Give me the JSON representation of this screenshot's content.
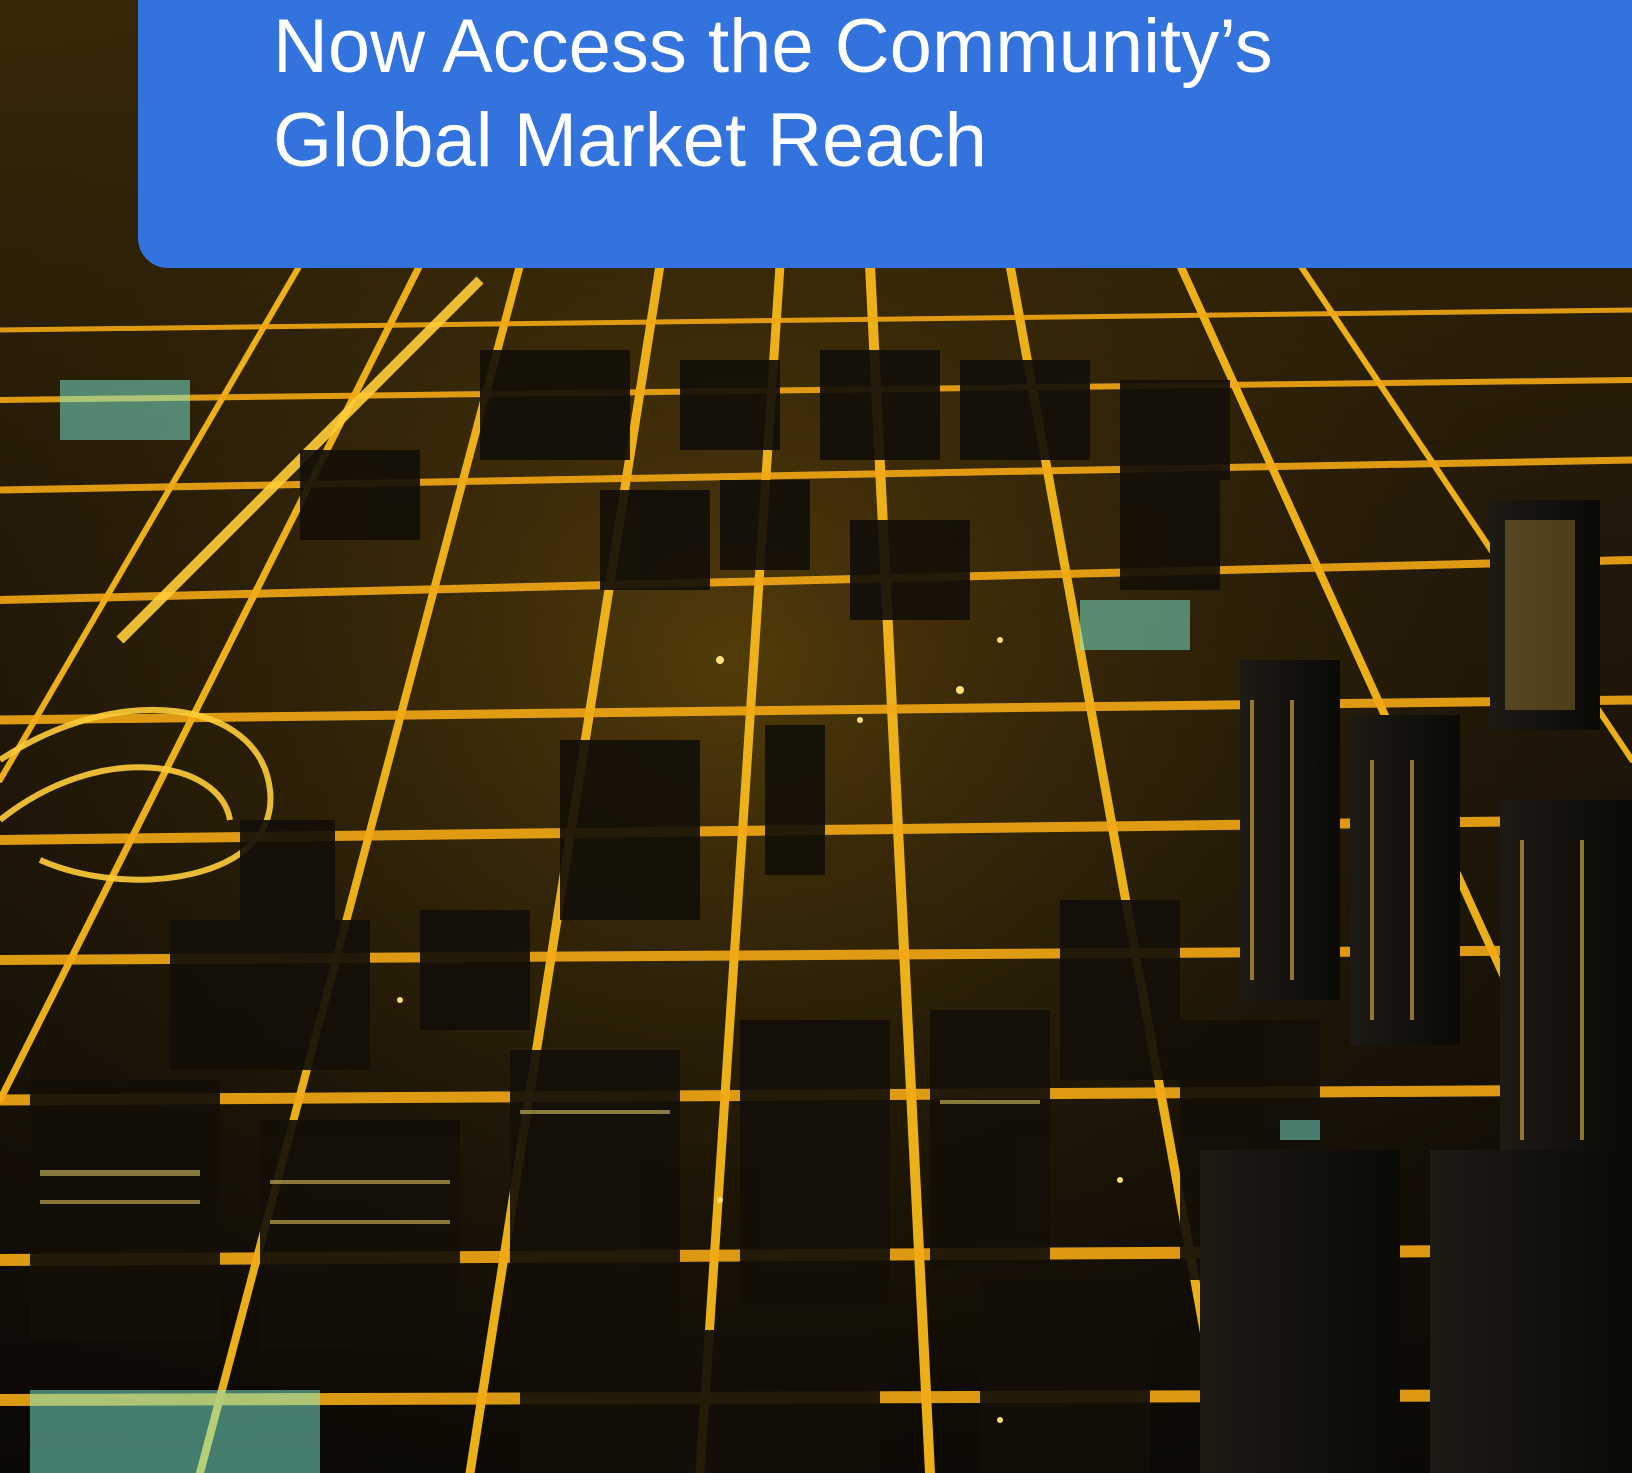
{
  "banner": {
    "headline_line1": "Now Access the Community’s",
    "headline_line2": "Global Market Reach",
    "background_color": "#3373dd",
    "text_color": "#ffffff"
  },
  "photo": {
    "subject": "aerial-city-night-icon"
  }
}
